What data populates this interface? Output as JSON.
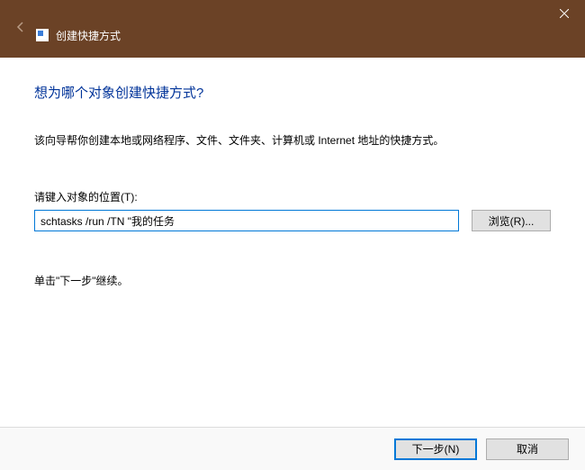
{
  "titlebar": {
    "title": "创建快捷方式"
  },
  "wizard": {
    "heading": "想为哪个对象创建快捷方式?",
    "description": "该向导帮你创建本地或网络程序、文件、文件夹、计算机或 Internet 地址的快捷方式。",
    "location_label": "请键入对象的位置(T):",
    "location_value": "schtasks /run /TN \"我的任务",
    "browse_label": "浏览(R)...",
    "hint": "单击\"下一步\"继续。"
  },
  "footer": {
    "next_label": "下一步(N)",
    "cancel_label": "取消"
  }
}
